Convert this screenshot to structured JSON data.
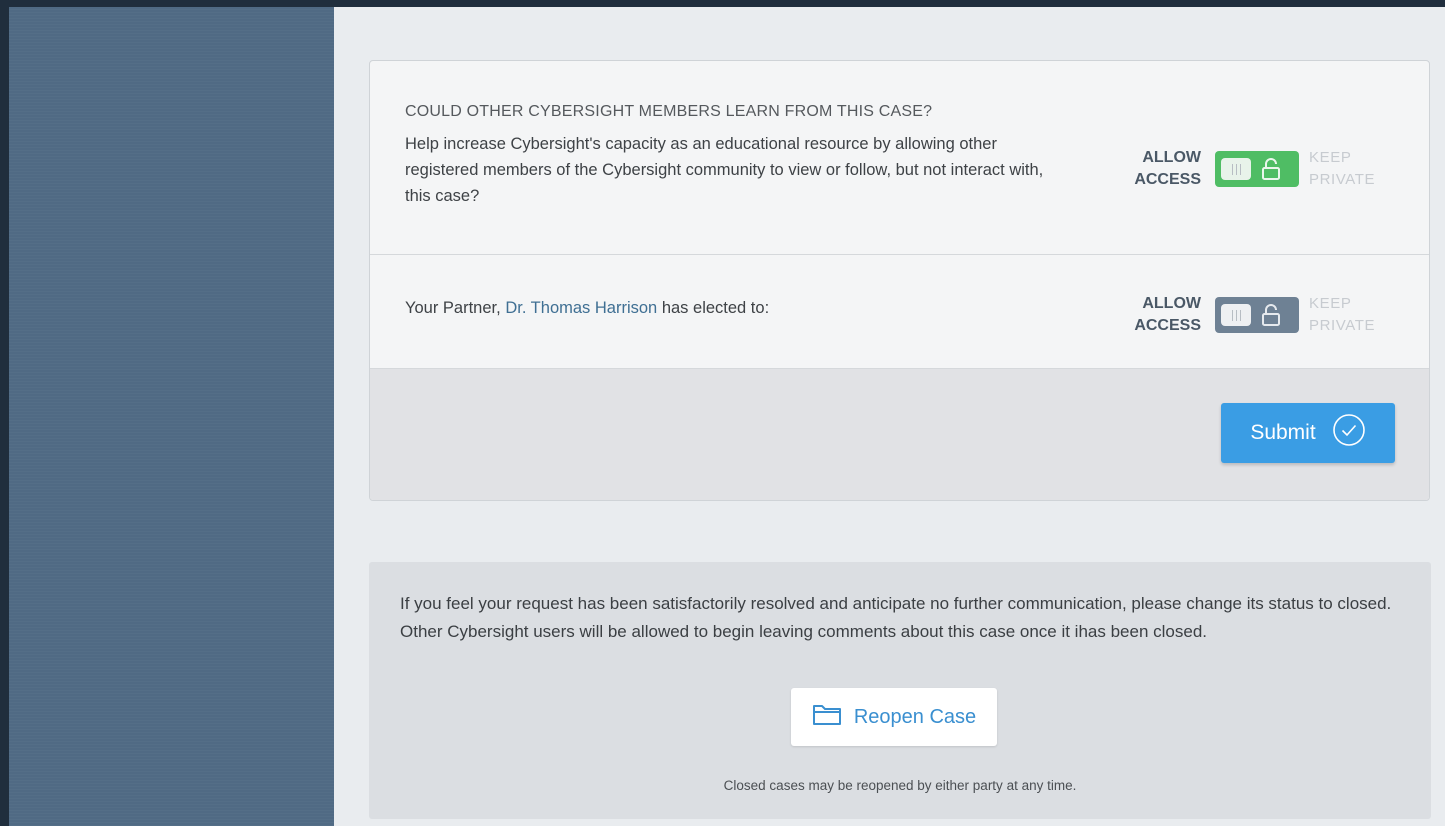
{
  "sharing": {
    "heading": "COULD OTHER CYBERSIGHT MEMBERS LEARN FROM THIS CASE?",
    "description": "Help increase Cybersight's capacity as an educational resource by allowing other registered members of the Cybersight community to view or follow, but not interact with, this case?",
    "toggle": {
      "allow_line1": "ALLOW",
      "allow_line2": "ACCESS",
      "keep_line1": "KEEP",
      "keep_line2": "PRIVATE",
      "state": "allow",
      "color": "#4fbd64"
    }
  },
  "partner": {
    "prefix": "Your Partner,",
    "name": "Dr. Thomas Harrison",
    "suffix": "has elected to:",
    "toggle": {
      "allow_line1": "ALLOW",
      "allow_line2": "ACCESS",
      "keep_line1": "KEEP",
      "keep_line2": "PRIVATE",
      "state": "allow",
      "disabled": true,
      "color": "#6e8194"
    }
  },
  "submit": {
    "label": "Submit",
    "icon": "check-circle-icon",
    "color": "#3a9de4"
  },
  "close_panel": {
    "text": "If you feel your request has been satisfactorily resolved and anticipate no further communication, please change its status to closed. Other Cybersight users will be allowed to begin leaving comments about this case once it ihas been closed.",
    "reopen_label": "Reopen Case",
    "reopen_icon": "folder-icon",
    "note": "Closed cases may be reopened by either party at any time."
  }
}
